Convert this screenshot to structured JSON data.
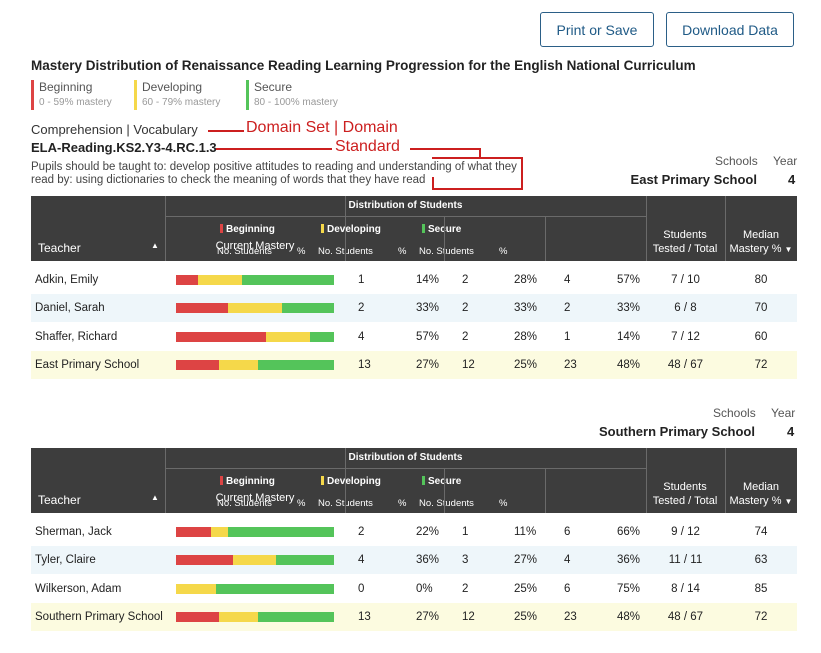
{
  "toolbar": {
    "print_label": "Print or Save",
    "download_label": "Download Data"
  },
  "title": "Mastery Distribution of Renaissance Reading Learning Progression for the English National Curriculum",
  "legend": [
    {
      "label": "Beginning",
      "range": "0 - 59% mastery",
      "color": "#dd4444"
    },
    {
      "label": "Developing",
      "range": "60 - 79% mastery",
      "color": "#f5d84a"
    },
    {
      "label": "Secure",
      "range": "80 - 100% mastery",
      "color": "#54c45a"
    }
  ],
  "breadcrumb": "Comprehension | Vocabulary",
  "standard_code": "ELA-Reading.KS2.Y3-4.RC.1.3",
  "standard_description": "Pupils should be taught to: develop positive attitudes to reading and understanding of what they read by: using dictionaries to check the meaning of words that they have read",
  "annotations": {
    "domain": "Domain Set | Domain",
    "standard": "Standard"
  },
  "table_headers": {
    "schools": "Schools",
    "year": "Year",
    "teacher": "Teacher",
    "distribution": "Distribution of Students",
    "current_mastery": "Current Mastery",
    "beginning": "Beginning",
    "developing": "Developing",
    "secure": "Secure",
    "no_students": "No. Students",
    "pct": "%",
    "tested_l1": "Students",
    "tested_l2": "Tested / Total",
    "median_l1": "Median",
    "median_l2": "Mastery %"
  },
  "schools": [
    {
      "name": "East Primary School",
      "year": "4",
      "rows": [
        {
          "teacher": "Adkin, Emily",
          "bn": "1",
          "bp": "14%",
          "dn": "2",
          "dp": "28%",
          "sn": "4",
          "sp": "57%",
          "tested": "7 / 10",
          "median": "80",
          "frac": [
            0.14,
            0.28,
            0.58
          ]
        },
        {
          "teacher": "Daniel, Sarah",
          "bn": "2",
          "bp": "33%",
          "dn": "2",
          "dp": "33%",
          "sn": "2",
          "sp": "33%",
          "tested": "6 / 8",
          "median": "70",
          "frac": [
            0.33,
            0.34,
            0.33
          ]
        },
        {
          "teacher": "Shaffer, Richard",
          "bn": "4",
          "bp": "57%",
          "dn": "2",
          "dp": "28%",
          "sn": "1",
          "sp": "14%",
          "tested": "7 / 12",
          "median": "60",
          "frac": [
            0.57,
            0.28,
            0.15
          ]
        },
        {
          "teacher": "East Primary School",
          "bn": "13",
          "bp": "27%",
          "dn": "12",
          "dp": "25%",
          "sn": "23",
          "sp": "48%",
          "tested": "48 / 67",
          "median": "72",
          "frac": [
            0.27,
            0.25,
            0.48
          ],
          "total": true
        }
      ]
    },
    {
      "name": "Southern Primary School",
      "year": "4",
      "rows": [
        {
          "teacher": "Sherman, Jack",
          "bn": "2",
          "bp": "22%",
          "dn": "1",
          "dp": "11%",
          "sn": "6",
          "sp": "66%",
          "tested": "9 / 12",
          "median": "74",
          "frac": [
            0.22,
            0.11,
            0.67
          ]
        },
        {
          "teacher": "Tyler, Claire",
          "bn": "4",
          "bp": "36%",
          "dn": "3",
          "dp": "27%",
          "sn": "4",
          "sp": "36%",
          "tested": "11 / 11",
          "median": "63",
          "frac": [
            0.36,
            0.27,
            0.37
          ]
        },
        {
          "teacher": "Wilkerson, Adam",
          "bn": "0",
          "bp": "0%",
          "dn": "2",
          "dp": "25%",
          "sn": "6",
          "sp": "75%",
          "tested": "8 / 14",
          "median": "85",
          "frac": [
            0.0,
            0.25,
            0.75
          ]
        },
        {
          "teacher": "Southern Primary School",
          "bn": "13",
          "bp": "27%",
          "dn": "12",
          "dp": "25%",
          "sn": "23",
          "sp": "48%",
          "tested": "48 / 67",
          "median": "72",
          "frac": [
            0.27,
            0.25,
            0.48
          ],
          "total": true
        }
      ]
    }
  ]
}
